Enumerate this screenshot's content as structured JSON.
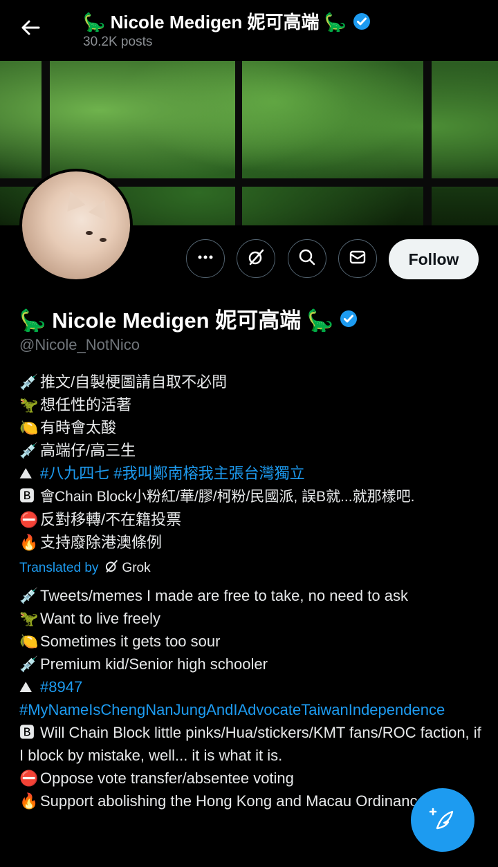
{
  "header": {
    "title": "🦕 Nicole Medigen 妮可高端 🦕",
    "posts": "30.2K posts"
  },
  "actions": {
    "follow_label": "Follow"
  },
  "profile": {
    "name": "🦕 Nicole Medigen 妮可高端 🦕",
    "handle": "@Nicole_NotNico"
  },
  "bio": {
    "l1_icon": "💉",
    "l1": "推文/自製梗圖請自取不必問",
    "l2_icon": "🦖",
    "l2": "想任性的活著",
    "l3_icon": "🍋",
    "l3": "有時會太酸",
    "l4_icon": "💉",
    "l4": "高端仔/高三生",
    "l5_icon": "⛰",
    "l5": "#八九四七 #我叫鄭南榕我主張台灣獨立",
    "l6_icon": "🅱",
    "l6": "會Chain Block小粉紅/華/膠/柯粉/民國派, 誤B就...就那樣吧.",
    "l7_icon": "⛔",
    "l7": "反對移轉/不在籍投票",
    "l8_icon": "🔥",
    "l8": "支持廢除港澳條例"
  },
  "translation": {
    "label": "Translated by",
    "provider": "Grok"
  },
  "tbio": {
    "l1_icon": "💉",
    "l1": "Tweets/memes I made are free to take, no need to ask",
    "l2_icon": "🦖",
    "l2": "Want to live freely",
    "l3_icon": "🍋",
    "l3": "Sometimes it gets too sour",
    "l4_icon": "💉",
    "l4": "Premium kid/Senior high schooler",
    "l5_icon": "⛰",
    "l5": "#8947",
    "l5b": "#MyNameIsChengNanJungAndIAdvocateTaiwanIndependence",
    "l6_icon": "🅱",
    "l6": "Will Chain Block little pinks/Hua/stickers/KMT fans/ROC faction, if I block by mistake, well... it is what it is.",
    "l7_icon": "⛔",
    "l7": "Oppose vote transfer/absentee voting",
    "l8_icon": "🔥",
    "l8": "Support abolishing the Hong Kong and Macau Ordinance"
  },
  "colors": {
    "accent": "#1d9bf0",
    "background": "#000000",
    "text": "#e7e9ea",
    "muted": "#71767b"
  },
  "icons": [
    "back-arrow-icon",
    "verified-badge-icon",
    "more-icon",
    "grok-icon",
    "search-icon",
    "mail-icon",
    "compose-icon"
  ]
}
